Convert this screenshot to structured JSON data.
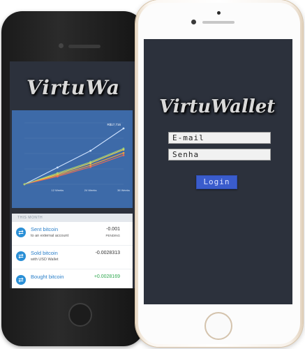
{
  "back_app": {
    "logo": "VirtuWa",
    "chart_data": {
      "type": "line",
      "categories": [
        "",
        "12 Weeks",
        "24 Weeks",
        "36 Weeks"
      ],
      "series": [
        {
          "values": [
            0,
            30,
            60,
            100
          ],
          "color": "#cfe3ff"
        },
        {
          "values": [
            0,
            18,
            38,
            62
          ],
          "color": "#f2d64a"
        },
        {
          "values": [
            0,
            16,
            34,
            56
          ],
          "color": "#f5a03a"
        },
        {
          "values": [
            0,
            14,
            31,
            52
          ],
          "color": "#e86a5a"
        },
        {
          "values": [
            0,
            20,
            40,
            64
          ],
          "color": "#9fd07a"
        }
      ],
      "top_label": "R$17,716",
      "ylim": [
        0,
        110
      ]
    },
    "transactions": {
      "header": "THIS MONTH",
      "items": [
        {
          "title": "Sent bitcoin",
          "subtitle": "to an external account",
          "amount": "-0.001",
          "status": "PENDING",
          "positive": false
        },
        {
          "title": "Sold bitcoin",
          "subtitle": "with USD Wallet",
          "amount": "-0.0028313",
          "status": "",
          "positive": false
        },
        {
          "title": "Bought bitcoin",
          "subtitle": "",
          "amount": "+0.0028169",
          "status": "",
          "positive": true
        }
      ]
    }
  },
  "front_app": {
    "logo": "VirtuWallet",
    "email_placeholder": "E-mail",
    "password_placeholder": "Senha",
    "login_label": "Login"
  }
}
